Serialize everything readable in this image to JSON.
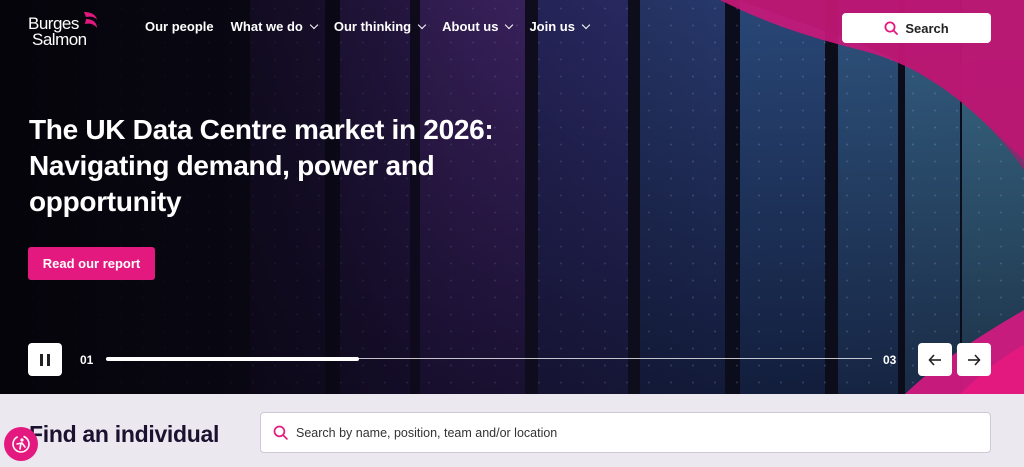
{
  "brand": {
    "logo_line1": "Burges",
    "logo_line2": "Salmon",
    "accent": "#e4197f"
  },
  "nav": {
    "items": [
      {
        "label": "Our people",
        "has_dropdown": false
      },
      {
        "label": "What we do",
        "has_dropdown": true
      },
      {
        "label": "Our thinking",
        "has_dropdown": true
      },
      {
        "label": "About us",
        "has_dropdown": true
      },
      {
        "label": "Join us",
        "has_dropdown": true
      }
    ],
    "search_label": "Search",
    "search_icon": "search-icon"
  },
  "hero": {
    "headline": "The UK Data Centre market in 2026: Navigating demand, power and opportunity",
    "cta_label": "Read our report",
    "carousel": {
      "current": "01",
      "total": "03",
      "progress": 0.33,
      "pause_icon": "pause-icon",
      "prev_icon": "arrow-left-icon",
      "next_icon": "arrow-right-icon"
    }
  },
  "find": {
    "title": "Find an individual",
    "placeholder": "Search by name, position, team and/or location",
    "value": ""
  },
  "accessibility": {
    "icon": "accessibility-icon"
  }
}
